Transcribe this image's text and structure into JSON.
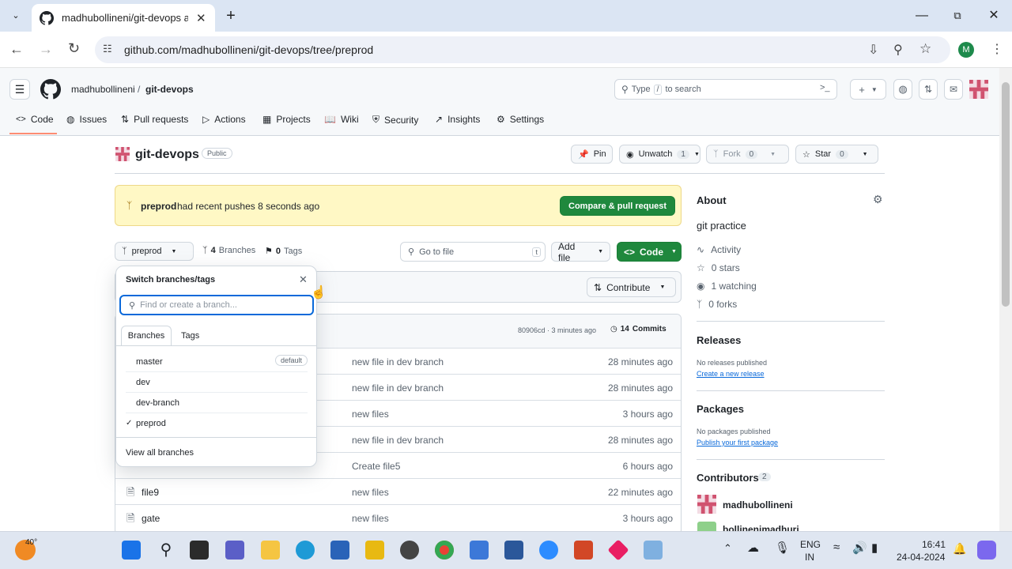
{
  "browser": {
    "tab_title": "madhubollineni/git-devops at",
    "url": "github.com/madhubollineni/git-devops/tree/preprod",
    "profile_initial": "M"
  },
  "github": {
    "breadcrumb_owner": "madhubollineni",
    "breadcrumb_sep": "/",
    "breadcrumb_repo": "git-devops",
    "search_prefix": "Type",
    "search_key": "/",
    "search_suffix": "to search",
    "nav": [
      "Code",
      "Issues",
      "Pull requests",
      "Actions",
      "Projects",
      "Wiki",
      "Security",
      "Insights",
      "Settings"
    ]
  },
  "repo": {
    "name": "git-devops",
    "visibility": "Public",
    "pin": "Pin",
    "unwatch": "Unwatch",
    "unwatch_count": "1",
    "fork": "Fork",
    "fork_count": "0",
    "star": "Star",
    "star_count": "0"
  },
  "banner": {
    "branch": "preprod",
    "text": "had recent pushes 8 seconds ago",
    "button": "Compare & pull request"
  },
  "branchbar": {
    "current": "preprod",
    "branches_count": "4",
    "branches_label": "Branches",
    "tags_count": "0",
    "tags_label": "Tags",
    "goto_placeholder": "Go to file",
    "goto_key": "t",
    "add_file": "Add file",
    "code": "Code",
    "contribute": "Contribute"
  },
  "commitbar": {
    "hash_time": "80906cd · 3 minutes ago",
    "commits_count": "14",
    "commits_label": "Commits"
  },
  "files": [
    {
      "name": "",
      "message": "new file in dev branch",
      "time": "28 minutes ago"
    },
    {
      "name": "",
      "message": "new file in dev branch",
      "time": "28 minutes ago"
    },
    {
      "name": "",
      "message": "new files",
      "time": "3 hours ago"
    },
    {
      "name": "",
      "message": "new file in dev branch",
      "time": "28 minutes ago"
    },
    {
      "name": "",
      "message": "Create file5",
      "time": "6 hours ago"
    },
    {
      "name": "file9",
      "message": "new files",
      "time": "22 minutes ago"
    },
    {
      "name": "gate",
      "message": "new files",
      "time": "3 hours ago"
    }
  ],
  "dropdown": {
    "title": "Switch branches/tags",
    "placeholder": "Find or create a branch...",
    "tab_branches": "Branches",
    "tab_tags": "Tags",
    "branches": [
      {
        "name": "master",
        "badge": "default"
      },
      {
        "name": "dev",
        "badge": ""
      },
      {
        "name": "dev-branch",
        "badge": ""
      },
      {
        "name": "preprod",
        "badge": "",
        "check": "✓"
      }
    ],
    "view_all": "View all branches"
  },
  "about": {
    "heading": "About",
    "description": "git practice",
    "activity": "Activity",
    "stars": "0 stars",
    "watching": "1 watching",
    "forks": "0 forks",
    "releases_heading": "Releases",
    "releases_none": "No releases published",
    "releases_link": "Create a new release",
    "packages_heading": "Packages",
    "packages_none": "No packages published",
    "packages_link": "Publish your first package",
    "contributors_heading": "Contributors",
    "contributors_count": "2",
    "contributors": [
      "madhubollineni",
      "bollinenimadhuri"
    ]
  },
  "taskbar": {
    "temp": "40°",
    "lang1": "ENG",
    "lang2": "IN",
    "time": "16:41",
    "date": "24-04-2024"
  },
  "colors": {
    "green": "#1f883d",
    "banner": "#fff8c5",
    "link": "#0969da",
    "tab_underline": "#fd8c73"
  }
}
